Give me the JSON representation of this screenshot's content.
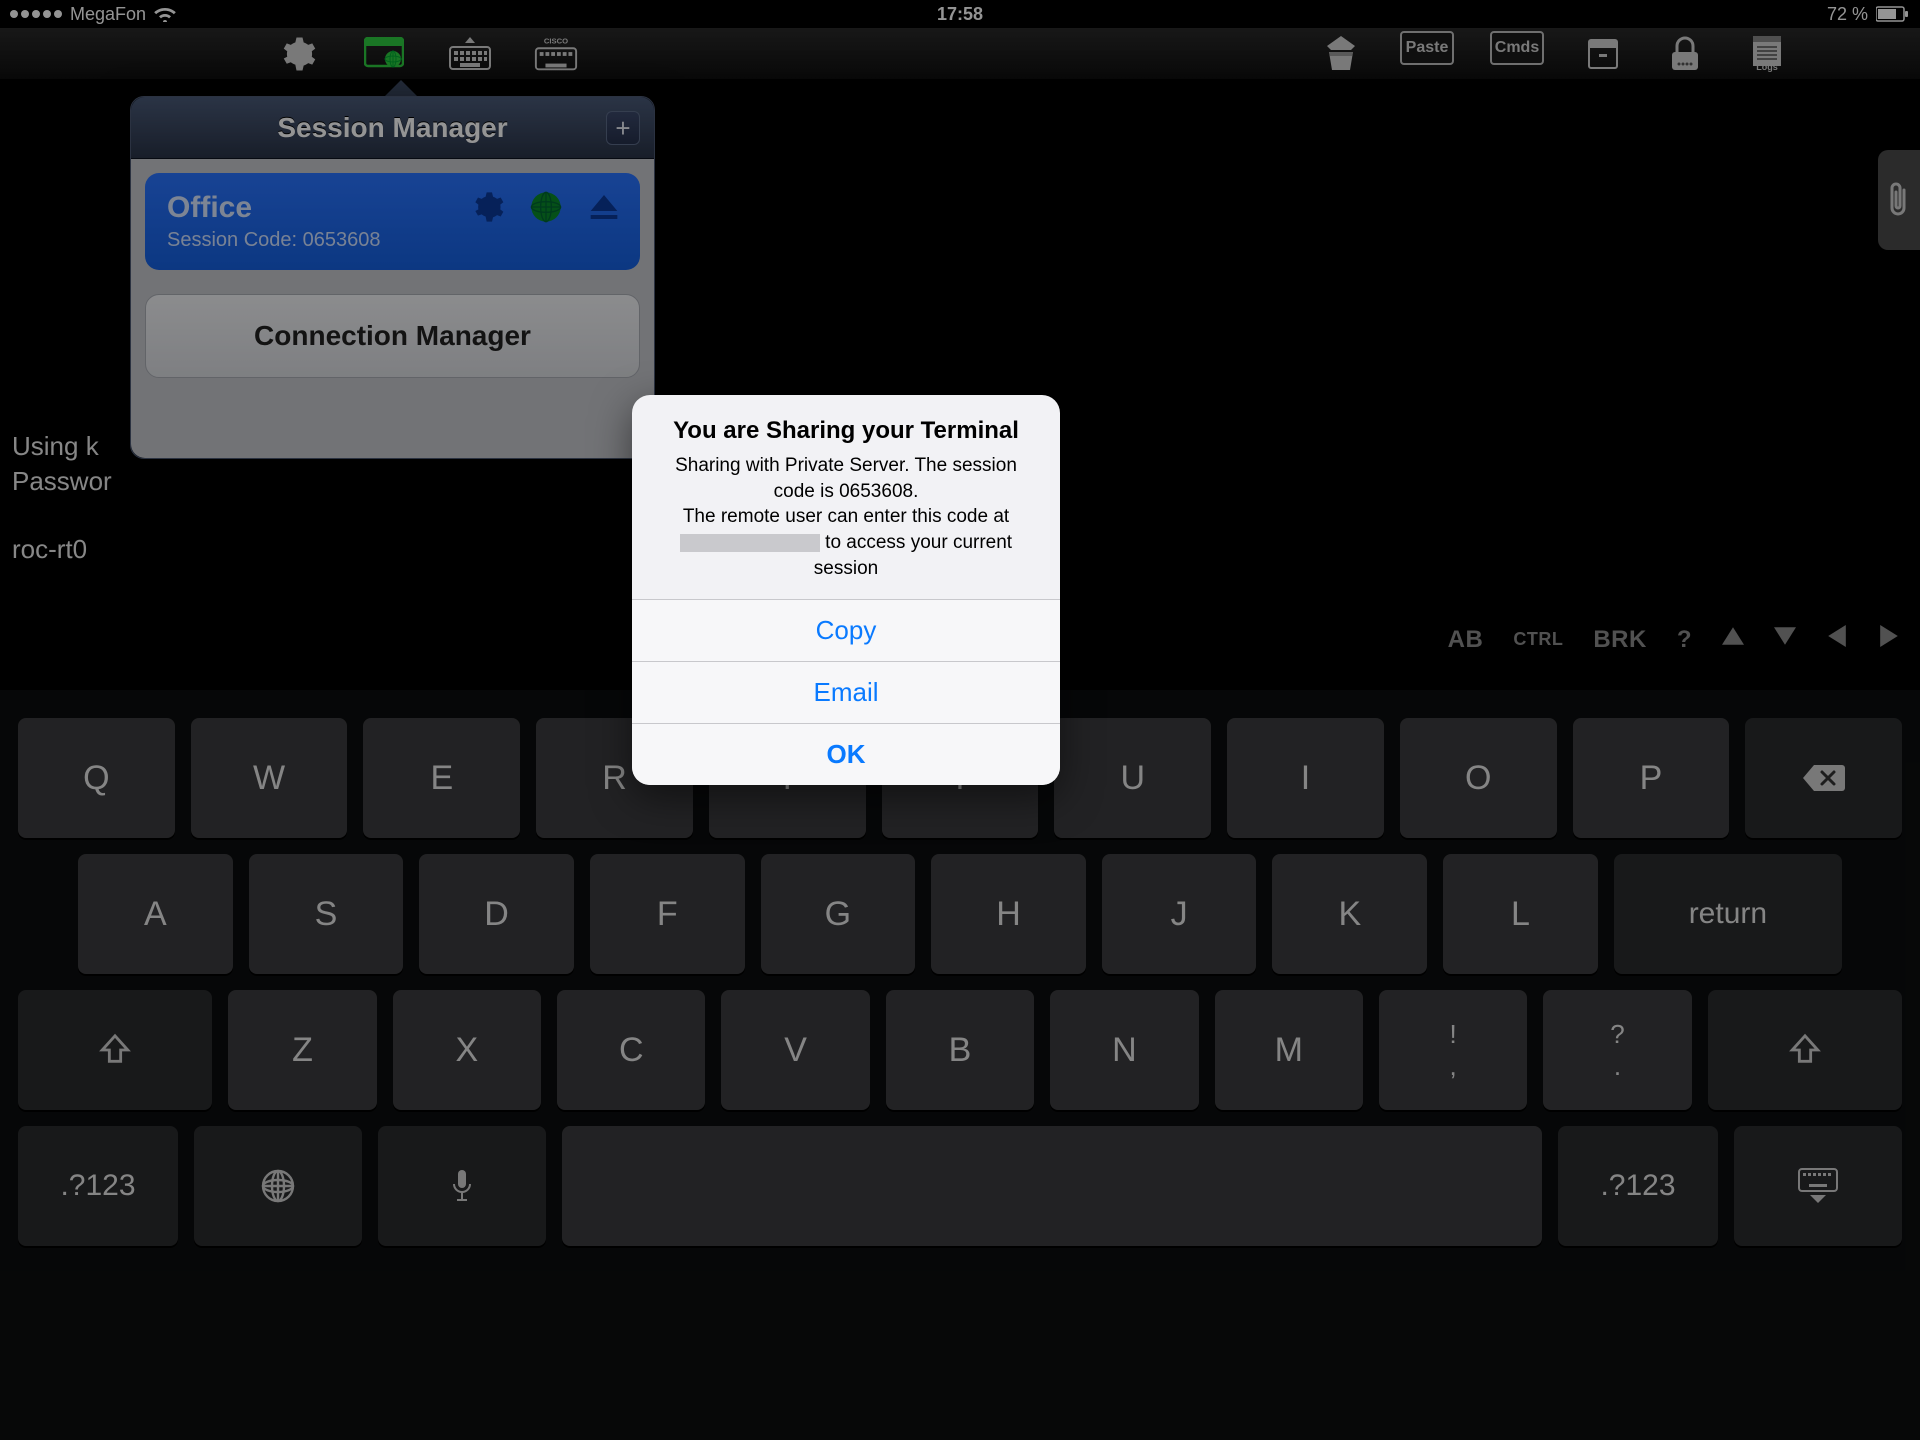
{
  "status_bar": {
    "carrier": "MegaFon",
    "time": "17:58",
    "battery": "72 %"
  },
  "toolbar": {
    "paste_label": "Paste",
    "cmds_label": "Cmds",
    "logs_label": "Logs"
  },
  "popover": {
    "title": "Session Manager",
    "session": {
      "name": "Office",
      "code_label": "Session Code: 0653608"
    },
    "conn_mgr": "Connection Manager"
  },
  "terminal": {
    "line1": "Using k",
    "line2": "Passwor",
    "line3": "roc-rt0"
  },
  "extra_keys": {
    "tab": "AB",
    "ctrl": "CTRL",
    "brk": "BRK",
    "q": "?"
  },
  "alert": {
    "title": "You are Sharing your Terminal",
    "msg1": "Sharing with Private Server. The session code is 0653608.",
    "msg2a": "The remote user can enter this code at ",
    "msg2b": " to access your current session",
    "copy": "Copy",
    "email": "Email",
    "ok": "OK"
  },
  "keyboard": {
    "row1": [
      "Q",
      "W",
      "E",
      "R",
      "T",
      "Y",
      "U",
      "I",
      "O",
      "P"
    ],
    "row2": [
      "A",
      "S",
      "D",
      "F",
      "G",
      "H",
      "J",
      "K",
      "L"
    ],
    "row3": [
      "Z",
      "X",
      "C",
      "V",
      "B",
      "N",
      "M"
    ],
    "return": "return",
    "numkey": ".?123",
    "punct1_top": "!",
    "punct1_bot": ",",
    "punct2_top": "?",
    "punct2_bot": "."
  }
}
